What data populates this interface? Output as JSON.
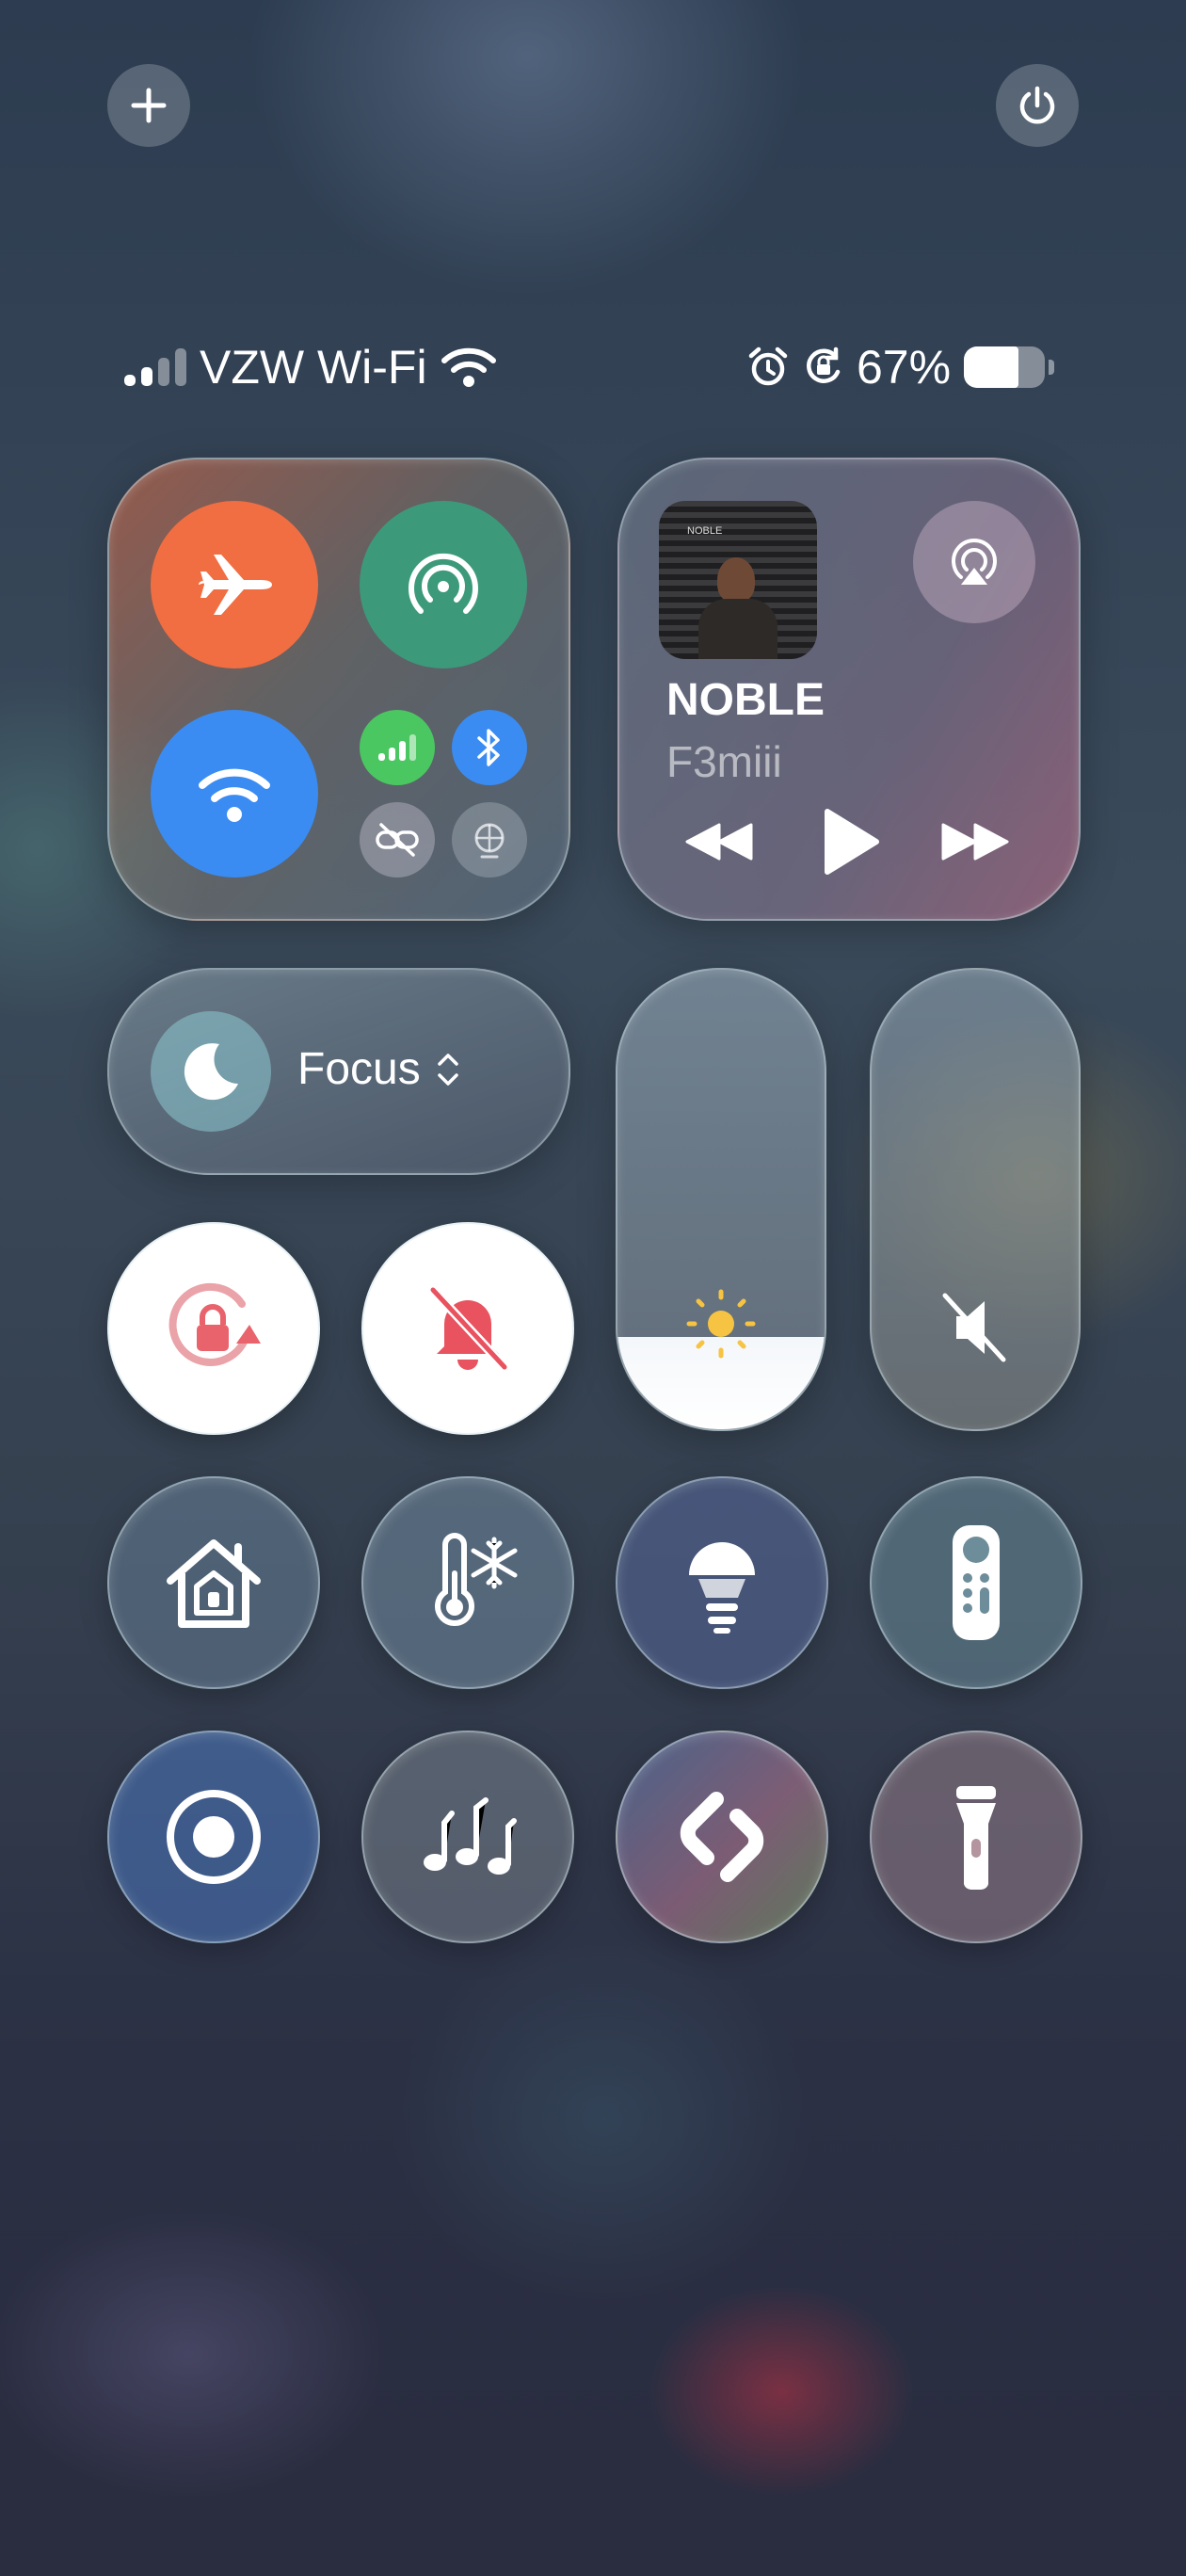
{
  "status_bar": {
    "carrier": "VZW Wi-Fi",
    "battery_percent": "67%",
    "battery_level": 0.67,
    "signal_bars": 2,
    "icons": [
      "cellular-signal-icon",
      "wifi-icon",
      "alarm-icon",
      "rotation-lock-icon",
      "battery-icon"
    ]
  },
  "top_controls": {
    "add_icon": "plus-icon",
    "power_icon": "power-icon"
  },
  "connectivity": {
    "airplane_mode": {
      "icon": "airplane-icon",
      "state": "on",
      "color": "#f26a3c"
    },
    "airdrop": {
      "icon": "airdrop-icon",
      "color": "#3f9b7c"
    },
    "wifi": {
      "icon": "wifi-icon",
      "state": "on",
      "color": "#3a8cf3"
    },
    "cellular": {
      "icon": "cellular-icon",
      "color": "#4cc864"
    },
    "bluetooth": {
      "icon": "bluetooth-icon",
      "color": "#3a8cf3"
    },
    "vpn_link": {
      "icon": "link-off-icon"
    },
    "satellite": {
      "icon": "satellite-icon"
    }
  },
  "now_playing": {
    "title": "NOBLE",
    "artist": "F3miii",
    "artwork_text": "NOBLE",
    "airplay_icon": "airplay-icon",
    "controls": [
      "rewind-icon",
      "play-icon",
      "fast-forward-icon"
    ]
  },
  "focus": {
    "label": "Focus",
    "icon": "moon-icon",
    "chevron_icon": "chevron-up-down-icon"
  },
  "sliders": {
    "brightness": {
      "icon": "sun-icon",
      "level": 0.2
    },
    "volume": {
      "icon": "speaker-muted-icon",
      "level": 0
    }
  },
  "toggles": {
    "rotation_lock": {
      "icon": "rotation-lock-icon",
      "state": "on",
      "color": "#e9636c"
    },
    "silent_mode": {
      "icon": "bell-slash-icon",
      "state": "on",
      "color": "#e9525f"
    }
  },
  "tiles_row1": [
    {
      "name": "home",
      "icon": "home-icon"
    },
    {
      "name": "climate",
      "icon": "thermometer-snowflake-icon"
    },
    {
      "name": "light",
      "icon": "light-bulb-icon"
    },
    {
      "name": "remote",
      "icon": "apple-tv-remote-icon"
    }
  ],
  "tiles_row2": [
    {
      "name": "screen-recording",
      "icon": "screen-record-icon"
    },
    {
      "name": "music-recognition",
      "icon": "music-notes-icon"
    },
    {
      "name": "shazam",
      "icon": "shazam-icon"
    },
    {
      "name": "flashlight",
      "icon": "flashlight-icon"
    }
  ]
}
